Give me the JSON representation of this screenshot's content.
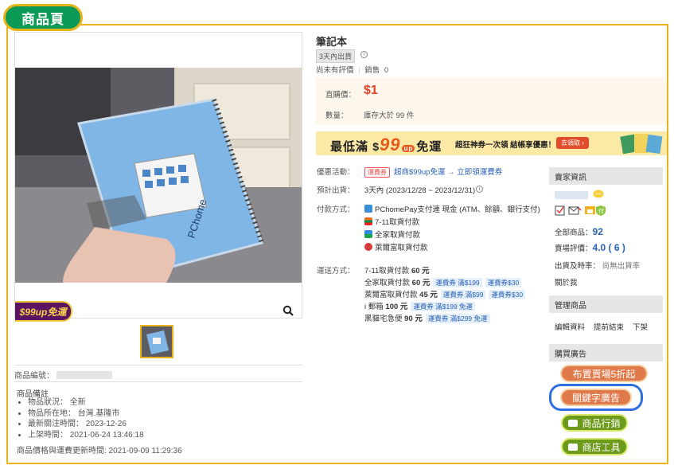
{
  "tab_label": "商品頁",
  "product": {
    "title": "筆記本",
    "ship_badge": "3天內出貨",
    "rating_text": "尚未有評價",
    "sales_label": "銷售",
    "sales_count": "0",
    "price_label": "直購價：",
    "price": "$1",
    "qty_label": "數量：",
    "stock_text": "庫存大於 99 件",
    "photo_brand": "PChome",
    "product_no_label": "商品編號：",
    "notes_title": "商品備註",
    "notes": [
      "物品狀況： 全新",
      "物品所在地： 台灣.基隆市",
      "最新關注時間： 2023-12-26",
      "上架時間： 2021-06-24 13:46:18"
    ],
    "update_text": "商品價格與運費更新時間: 2021-09-09 11:29:36"
  },
  "promo_badge": "$99up免運",
  "banner": {
    "prefix": "最低滿",
    "dollar": "$",
    "amount": "99",
    "up": "up",
    "suffix": "免運",
    "sub": "超狂神券一次領 結帳享優惠！",
    "button": "去領取 ›"
  },
  "details": {
    "promo_label": "優惠活動：",
    "promo_coupon": "運費券",
    "promo_link": "超商$99up免運 → 立即領運費券",
    "ship_label": "預計出貨：",
    "ship_value": "3天內 (2023/12/28 ~ 2023/12/31)",
    "pay_label": "付款方式：",
    "pay_methods": [
      "PChomePay支付連 現金 (ATM、餘額、銀行支付)",
      "7-11取貨付款",
      "全家取貨付款",
      "萊爾富取貨付款"
    ],
    "delivery_label": "運送方式：",
    "delivery": [
      {
        "text": "7-11取貨付款",
        "price": "60 元",
        "tags": []
      },
      {
        "text": "全家取貨付款",
        "price": "60 元",
        "tags": [
          "運費券 滿$199",
          "運費券$30"
        ]
      },
      {
        "text": "萊爾富取貨付款",
        "price": "45 元",
        "tags": [
          "運費券 滿$99",
          "運費券$30"
        ]
      },
      {
        "text": "i 郵箱",
        "price": "100 元",
        "tags": [
          "運費券 滿$199 免運"
        ]
      },
      {
        "text": "黑貓宅急便",
        "price": "90 元",
        "tags": [
          "運費券 滿$299 免運"
        ]
      }
    ]
  },
  "sidebar": {
    "seller_head": "賣家資訊",
    "total_label": "全部商品：",
    "total_value": "92",
    "rating_label": "賣場評價：",
    "rating_value": "4.0 ( 6 )",
    "rate_label": "出貨及時率：",
    "rate_value": "尚無出貨率",
    "about": "關於我",
    "manage_head": "管理商品",
    "manage_links": [
      "編輯資料",
      "提前結束",
      "下架"
    ],
    "ads_head": "購買廣告",
    "ads": [
      "布置賣場5折起",
      "關鍵字廣告",
      "商品行銷",
      "商店工具"
    ]
  },
  "colors": {
    "accent_green": "#0c9a57",
    "frame_gold": "#e8b419",
    "price_red": "#e54028",
    "link_blue": "#2a62b8",
    "highlight_blue": "#2f6fe0"
  }
}
